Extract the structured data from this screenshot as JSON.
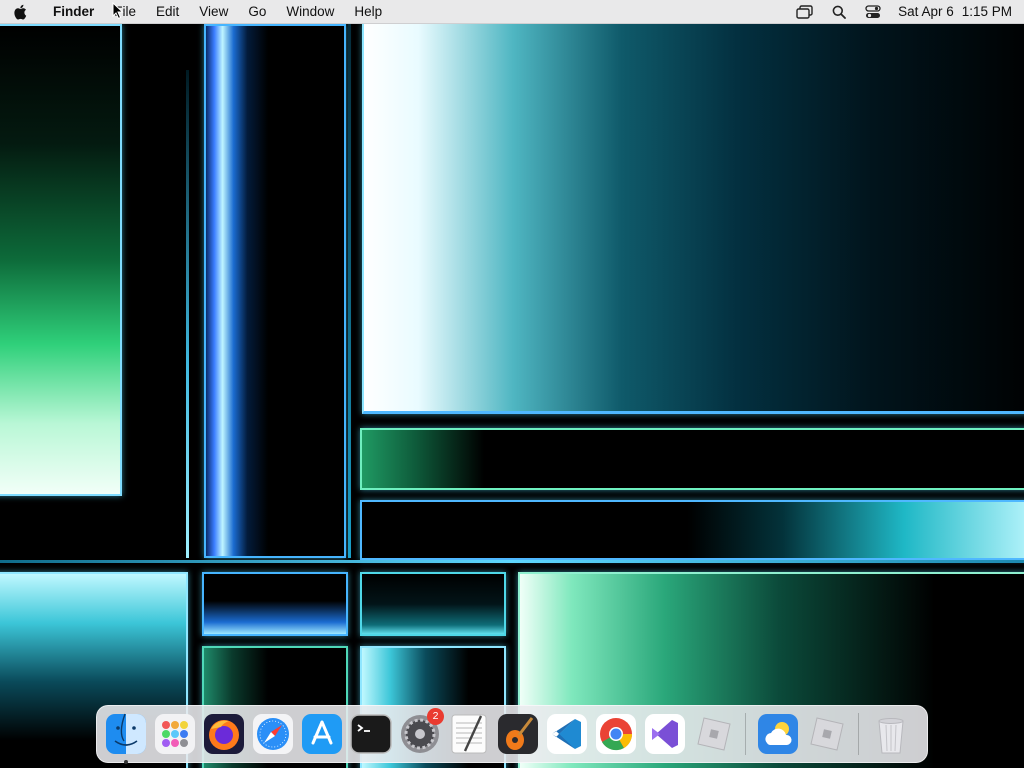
{
  "menubar": {
    "apple_icon": "apple-logo-icon",
    "app_name": "Finder",
    "menus": [
      "File",
      "Edit",
      "View",
      "Go",
      "Window",
      "Help"
    ],
    "status_icons": [
      "screen-mirroring-icon",
      "spotlight-search-icon",
      "control-center-icon"
    ],
    "clock": {
      "date": "Sat Apr 6",
      "time": "1:15 PM"
    }
  },
  "dock": {
    "apps": [
      {
        "name": "Finder",
        "icon": "finder-icon",
        "running": true
      },
      {
        "name": "Launchpad",
        "icon": "launchpad-icon"
      },
      {
        "name": "Firefox",
        "icon": "firefox-icon"
      },
      {
        "name": "Safari",
        "icon": "safari-icon"
      },
      {
        "name": "App Store",
        "icon": "app-store-icon"
      },
      {
        "name": "Terminal",
        "icon": "terminal-icon"
      },
      {
        "name": "System Settings",
        "icon": "system-settings-icon",
        "badge": "2"
      },
      {
        "name": "TextEdit",
        "icon": "textedit-icon"
      },
      {
        "name": "GarageBand",
        "icon": "garageband-icon"
      },
      {
        "name": "Visual Studio Code",
        "icon": "vscode-icon"
      },
      {
        "name": "Google Chrome",
        "icon": "chrome-icon"
      },
      {
        "name": "Visual Studio",
        "icon": "visual-studio-icon"
      },
      {
        "name": "Roblox",
        "icon": "roblox-icon"
      }
    ],
    "recent": [
      {
        "name": "Weather",
        "icon": "weather-icon"
      },
      {
        "name": "Roblox Studio",
        "icon": "roblox-studio-icon"
      }
    ],
    "trash": {
      "name": "Trash",
      "icon": "trash-icon"
    }
  },
  "colors": {
    "menubar_bg": "#e9e9ea",
    "badge": "#ea3b30",
    "wallpaper_accent_cyan": "#7ef3ff",
    "wallpaper_accent_green": "#2fd07a"
  }
}
